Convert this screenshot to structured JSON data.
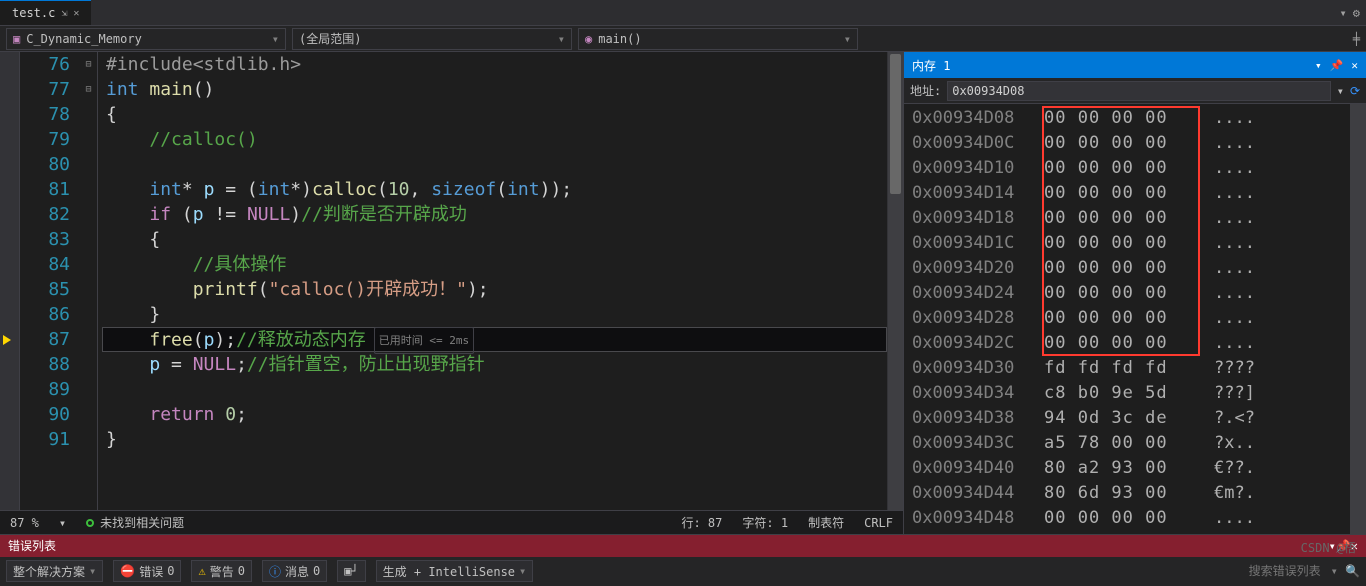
{
  "tabs": {
    "file": "test.c"
  },
  "context": {
    "project_label": "C_Dynamic_Memory",
    "scope_label": "(全局范围)",
    "fn_label": "main()"
  },
  "code": {
    "lines": [
      {
        "num": "76",
        "fold": "",
        "hl": false,
        "segs": [
          {
            "c": "tok-m",
            "t": "#include"
          },
          {
            "c": "tok-m",
            "t": "<stdlib.h>"
          }
        ]
      },
      {
        "num": "77",
        "fold": "⊟",
        "hl": false,
        "segs": [
          {
            "c": "tok-k",
            "t": "int"
          },
          {
            "c": "",
            "t": " "
          },
          {
            "c": "tok-fn",
            "t": "main"
          },
          {
            "c": "tok-par",
            "t": "()"
          }
        ]
      },
      {
        "num": "78",
        "fold": "",
        "hl": false,
        "segs": [
          {
            "c": "tok-par",
            "t": "{"
          }
        ]
      },
      {
        "num": "79",
        "fold": "",
        "hl": false,
        "segs": [
          {
            "c": "",
            "t": "    "
          },
          {
            "c": "tok-cmt",
            "t": "//calloc()"
          }
        ]
      },
      {
        "num": "80",
        "fold": "",
        "hl": false,
        "segs": []
      },
      {
        "num": "81",
        "fold": "",
        "hl": false,
        "segs": [
          {
            "c": "",
            "t": "    "
          },
          {
            "c": "tok-k",
            "t": "int"
          },
          {
            "c": "tok-par",
            "t": "* "
          },
          {
            "c": "tok-id",
            "t": "p"
          },
          {
            "c": "",
            "t": " = ("
          },
          {
            "c": "tok-k",
            "t": "int"
          },
          {
            "c": "tok-par",
            "t": "*)"
          },
          {
            "c": "tok-fn",
            "t": "calloc"
          },
          {
            "c": "tok-par",
            "t": "("
          },
          {
            "c": "tok-num",
            "t": "10"
          },
          {
            "c": "tok-par",
            "t": ", "
          },
          {
            "c": "tok-k",
            "t": "sizeof"
          },
          {
            "c": "tok-par",
            "t": "("
          },
          {
            "c": "tok-k",
            "t": "int"
          },
          {
            "c": "tok-par",
            "t": "));"
          }
        ]
      },
      {
        "num": "82",
        "fold": "⊟",
        "hl": false,
        "segs": [
          {
            "c": "",
            "t": "    "
          },
          {
            "c": "tok-def",
            "t": "if"
          },
          {
            "c": "",
            "t": " ("
          },
          {
            "c": "tok-id",
            "t": "p"
          },
          {
            "c": "",
            "t": " != "
          },
          {
            "c": "tok-def",
            "t": "NULL"
          },
          {
            "c": "tok-par",
            "t": ")"
          },
          {
            "c": "tok-cmt",
            "t": "//判断是否开辟成功"
          }
        ]
      },
      {
        "num": "83",
        "fold": "",
        "hl": false,
        "segs": [
          {
            "c": "",
            "t": "    "
          },
          {
            "c": "tok-par",
            "t": "{"
          }
        ]
      },
      {
        "num": "84",
        "fold": "",
        "hl": false,
        "segs": [
          {
            "c": "",
            "t": "        "
          },
          {
            "c": "tok-cmt",
            "t": "//具体操作"
          }
        ]
      },
      {
        "num": "85",
        "fold": "",
        "hl": false,
        "segs": [
          {
            "c": "",
            "t": "        "
          },
          {
            "c": "tok-fn",
            "t": "printf"
          },
          {
            "c": "tok-par",
            "t": "("
          },
          {
            "c": "tok-str",
            "t": "\"calloc()开辟成功！\""
          },
          {
            "c": "tok-par",
            "t": ");"
          }
        ]
      },
      {
        "num": "86",
        "fold": "",
        "hl": false,
        "segs": [
          {
            "c": "",
            "t": "    "
          },
          {
            "c": "tok-par",
            "t": "}"
          }
        ]
      },
      {
        "num": "87",
        "fold": "",
        "hl": true,
        "segs": [
          {
            "c": "",
            "t": "    "
          },
          {
            "c": "tok-fn",
            "t": "free"
          },
          {
            "c": "tok-par",
            "t": "("
          },
          {
            "c": "tok-id",
            "t": "p"
          },
          {
            "c": "tok-par",
            "t": ");"
          },
          {
            "c": "tok-cmt",
            "t": "//释放动态内存"
          }
        ],
        "codelens": "已用时间 <= 2ms"
      },
      {
        "num": "88",
        "fold": "",
        "hl": false,
        "segs": [
          {
            "c": "",
            "t": "    "
          },
          {
            "c": "tok-id",
            "t": "p"
          },
          {
            "c": "",
            "t": " = "
          },
          {
            "c": "tok-def",
            "t": "NULL"
          },
          {
            "c": "tok-par",
            "t": ";"
          },
          {
            "c": "tok-cmt",
            "t": "//指针置空，防止出现野指针"
          }
        ]
      },
      {
        "num": "89",
        "fold": "",
        "hl": false,
        "segs": []
      },
      {
        "num": "90",
        "fold": "",
        "hl": false,
        "segs": [
          {
            "c": "",
            "t": "    "
          },
          {
            "c": "tok-def",
            "t": "return"
          },
          {
            "c": "",
            "t": " "
          },
          {
            "c": "tok-num",
            "t": "0"
          },
          {
            "c": "tok-par",
            "t": ";"
          }
        ]
      },
      {
        "num": "91",
        "fold": "",
        "hl": false,
        "segs": [
          {
            "c": "tok-par",
            "t": "}"
          }
        ]
      }
    ]
  },
  "status": {
    "zoom": "87 %",
    "issues": "未找到相关问题",
    "line": "行: 87",
    "col": "字符: 1",
    "tabs": "制表符",
    "eol": "CRLF"
  },
  "memory": {
    "title": "内存 1",
    "addr_label": "地址:",
    "addr_value": "0x00934D08",
    "rows": [
      {
        "addr": "0x00934D08",
        "hex": "00 00 00 00",
        "ascii": "...."
      },
      {
        "addr": "0x00934D0C",
        "hex": "00 00 00 00",
        "ascii": "...."
      },
      {
        "addr": "0x00934D10",
        "hex": "00 00 00 00",
        "ascii": "...."
      },
      {
        "addr": "0x00934D14",
        "hex": "00 00 00 00",
        "ascii": "...."
      },
      {
        "addr": "0x00934D18",
        "hex": "00 00 00 00",
        "ascii": "...."
      },
      {
        "addr": "0x00934D1C",
        "hex": "00 00 00 00",
        "ascii": "...."
      },
      {
        "addr": "0x00934D20",
        "hex": "00 00 00 00",
        "ascii": "...."
      },
      {
        "addr": "0x00934D24",
        "hex": "00 00 00 00",
        "ascii": "...."
      },
      {
        "addr": "0x00934D28",
        "hex": "00 00 00 00",
        "ascii": "...."
      },
      {
        "addr": "0x00934D2C",
        "hex": "00 00 00 00",
        "ascii": "...."
      },
      {
        "addr": "0x00934D30",
        "hex": "fd fd fd fd",
        "ascii": "????"
      },
      {
        "addr": "0x00934D34",
        "hex": "c8 b0 9e 5d",
        "ascii": "???]"
      },
      {
        "addr": "0x00934D38",
        "hex": "94 0d 3c de",
        "ascii": "?.<?"
      },
      {
        "addr": "0x00934D3C",
        "hex": "a5 78 00 00",
        "ascii": "?x.."
      },
      {
        "addr": "0x00934D40",
        "hex": "80 a2 93 00",
        "ascii": "€??."
      },
      {
        "addr": "0x00934D44",
        "hex": "80 6d 93 00",
        "ascii": "€m?."
      },
      {
        "addr": "0x00934D48",
        "hex": "00 00 00 00",
        "ascii": "...."
      }
    ]
  },
  "errorlist": {
    "title": "错误列表",
    "solution": "整个解决方案",
    "err_label": "错误",
    "err_count": "0",
    "warn_label": "警告",
    "warn_count": "0",
    "msg_label": "消息",
    "msg_count": "0",
    "build_label": "生成 + IntelliSense",
    "search_placeholder": "搜索错误列表"
  },
  "watermark": "CSDN @梧"
}
